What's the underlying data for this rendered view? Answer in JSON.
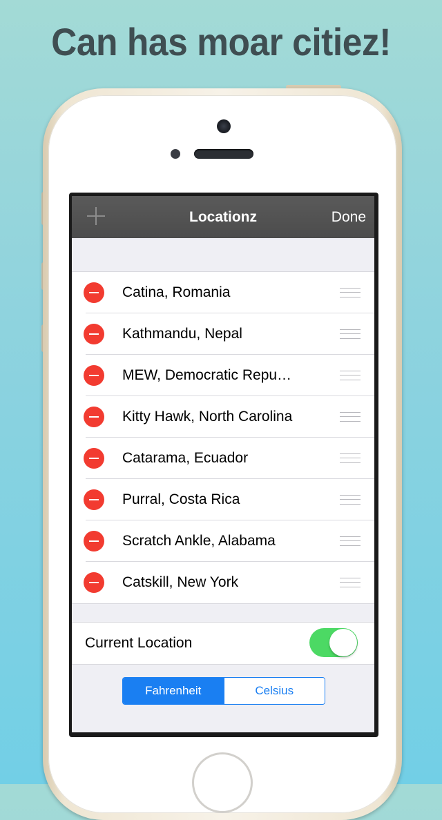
{
  "headline": "Can has moar citiez!",
  "navbar": {
    "add_icon": "plus-icon",
    "title": "Locationz",
    "done_label": "Done"
  },
  "locations": [
    {
      "name": "Catina, Romania"
    },
    {
      "name": "Kathmandu, Nepal"
    },
    {
      "name": "MEW, Democratic Repu…"
    },
    {
      "name": "Kitty Hawk, North Carolina"
    },
    {
      "name": "Catarama, Ecuador"
    },
    {
      "name": "Purral, Costa Rica"
    },
    {
      "name": "Scratch Ankle, Alabama"
    },
    {
      "name": "Catskill, New York"
    }
  ],
  "current_location": {
    "label": "Current Location",
    "enabled": true
  },
  "units": {
    "options": [
      "Fahrenheit",
      "Celsius"
    ],
    "selected": "Fahrenheit"
  },
  "colors": {
    "delete": "#f23b30",
    "toggle_on": "#4cd964",
    "accent": "#1a7ff2",
    "headline": "#3f4e52"
  }
}
